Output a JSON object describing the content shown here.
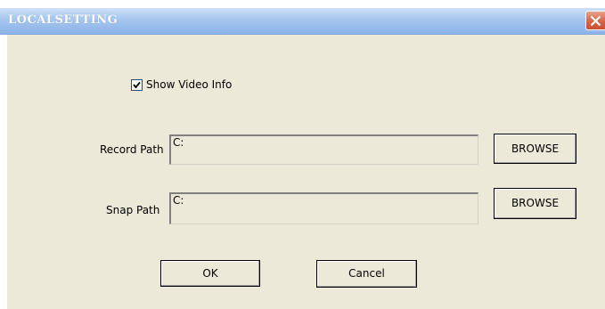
{
  "window": {
    "title": "LOCALSETTING"
  },
  "show_video_info": {
    "label": "Show Video Info",
    "checked": true
  },
  "record_path": {
    "label": "Record Path",
    "value": "C:",
    "browse_label": "BROWSE"
  },
  "snap_path": {
    "label": "Snap Path",
    "value": "C:",
    "browse_label": "BROWSE"
  },
  "buttons": {
    "ok_label": "OK",
    "cancel_label": "Cancel"
  },
  "icons": {
    "close": "close-icon",
    "check": "checkmark-icon"
  }
}
